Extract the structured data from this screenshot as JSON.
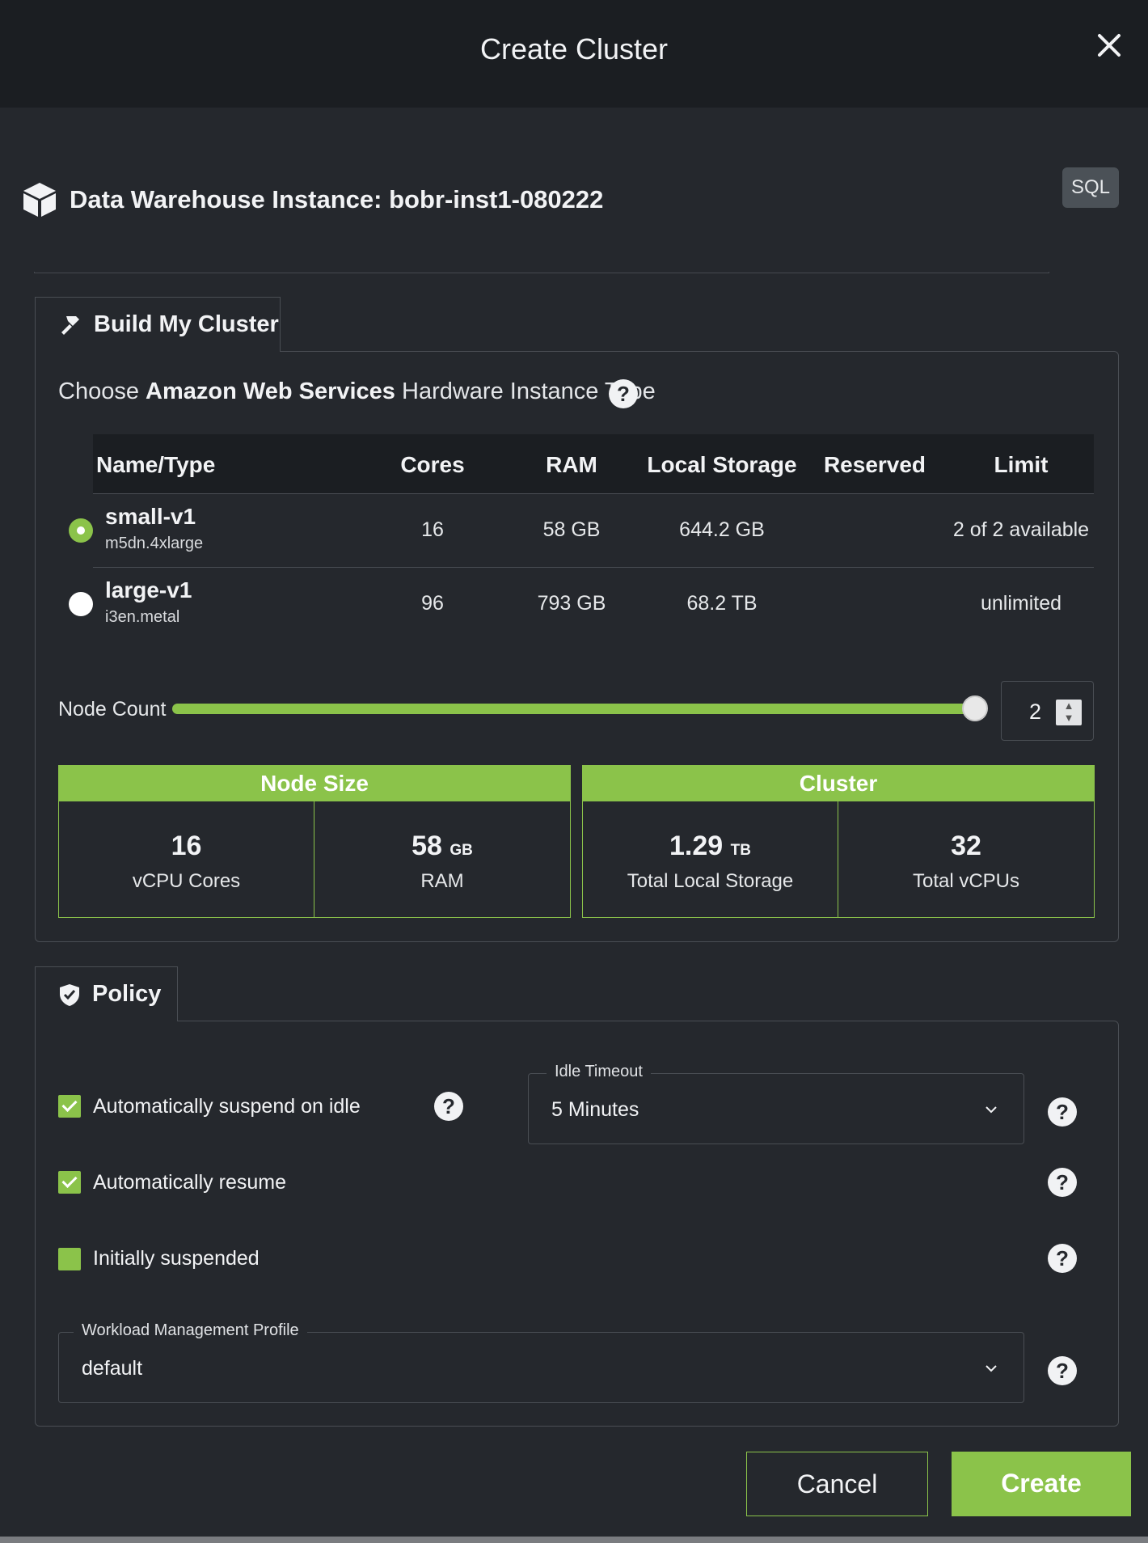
{
  "dialog": {
    "title": "Create Cluster"
  },
  "instance": {
    "title": "Data Warehouse Instance: bobr-inst1-080222",
    "badge": "SQL"
  },
  "build": {
    "tab_label": "Build My Cluster",
    "hw_prefix": "Choose ",
    "hw_vendor": "Amazon Web Services",
    "hw_suffix": " Hardware Instance Type",
    "columns": [
      "Name/Type",
      "Cores",
      "RAM",
      "Local Storage",
      "Reserved",
      "Limit"
    ],
    "rows": [
      {
        "name": "small-v1",
        "type": "m5dn.4xlarge",
        "cores": "16",
        "ram": "58 GB",
        "storage": "644.2 GB",
        "reserved": "",
        "limit": "2 of 2 available",
        "selected": true
      },
      {
        "name": "large-v1",
        "type": "i3en.metal",
        "cores": "96",
        "ram": "793 GB",
        "storage": "68.2 TB",
        "reserved": "",
        "limit": "unlimited",
        "selected": false
      }
    ],
    "node_count_label": "Node Count",
    "node_count": "2",
    "slider_fraction": 1.0,
    "node_size": {
      "header": "Node Size",
      "cores_value": "16",
      "cores_label": "vCPU Cores",
      "ram_value": "58",
      "ram_unit": "GB",
      "ram_label": "RAM"
    },
    "cluster": {
      "header": "Cluster",
      "storage_value": "1.29",
      "storage_unit": "TB",
      "storage_label": "Total Local Storage",
      "vcpu_value": "32",
      "vcpu_label": "Total vCPUs"
    }
  },
  "policy": {
    "tab_label": "Policy",
    "auto_suspend": {
      "label": "Automatically suspend on idle",
      "checked": true
    },
    "idle_timeout": {
      "legend": "Idle Timeout",
      "value": "5 Minutes"
    },
    "auto_resume": {
      "label": "Automatically resume",
      "checked": true
    },
    "initially_suspended": {
      "label": "Initially suspended",
      "checked": false
    },
    "workload": {
      "legend": "Workload Management Profile",
      "value": "default"
    }
  },
  "footer": {
    "cancel": "Cancel",
    "create": "Create"
  },
  "colors": {
    "accent": "#8bc34a",
    "background": "#25282d",
    "header": "#1b1e22"
  }
}
